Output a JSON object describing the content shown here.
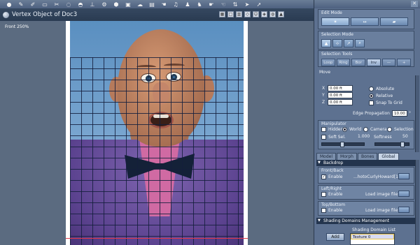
{
  "window": {
    "title": "Vertex Object of Doc3",
    "zoom_label": "Front 250%"
  },
  "toolbar": {
    "icons": [
      "sphere-icon",
      "pen-icon",
      "brush-icon",
      "eraser-icon",
      "scissors-icon",
      "lasso-icon",
      "dome-icon",
      "tack-icon",
      "gear-icon",
      "nut-icon",
      "cube-icon",
      "cloud-icon",
      "book-icon",
      "hand-icon",
      "bell-icon",
      "person-icon",
      "person-icon",
      "glove-icon",
      "glove-icon",
      "arrows-icon",
      "cursor-icon",
      "cursor-icon"
    ]
  },
  "right_panel": {
    "edit_mode": {
      "label": "Edit Mode"
    },
    "selection_mode": {
      "label": "Selection Mode"
    },
    "selection_tools": {
      "label": "Selection Tools",
      "buttons": [
        "Loop",
        "Ring",
        "Bor",
        "Inv",
        "—",
        "+"
      ],
      "active_index": 3
    },
    "move": {
      "label": "Move",
      "x_label": "X",
      "x_value": "0.00 ft",
      "y_label": "Y",
      "y_value": "0.00 ft",
      "z_label": "Z",
      "z_value": "0.00 ft",
      "absolute": "Absolute",
      "relative": "Relative",
      "snap": "Snap To Grid",
      "edge_label": "Edge Propagation",
      "edge_value": "10.00",
      "edge_unit": "°"
    },
    "manipulator": {
      "label": "Manipulator",
      "hidden": "Hidden",
      "world": "World",
      "camera": "Camera",
      "selection": "Selection",
      "soft_sel": "Soft Sel.",
      "soft_value": "1.000",
      "softness_label": "Softness",
      "softness_value": "50"
    },
    "tabs": [
      "Model",
      "Morph",
      "Bones",
      "Global"
    ],
    "active_tab": 3,
    "backdrop": {
      "header": "Backdrop",
      "front_back": {
        "label": "Front/Back",
        "enable": "Enable",
        "file": "...hotoCurlyHoward[1].jpg"
      },
      "left_right": {
        "label": "Left/Right",
        "enable": "Enable",
        "load": "Load image file:"
      },
      "top_bottom": {
        "label": "Top/Bottom",
        "enable": "Enable",
        "load": "Load image file:"
      }
    },
    "shading": {
      "header": "Shading Domains Management",
      "list_label": "Shading Domain List",
      "add": "Add",
      "items": [
        "Texture 0"
      ]
    }
  }
}
